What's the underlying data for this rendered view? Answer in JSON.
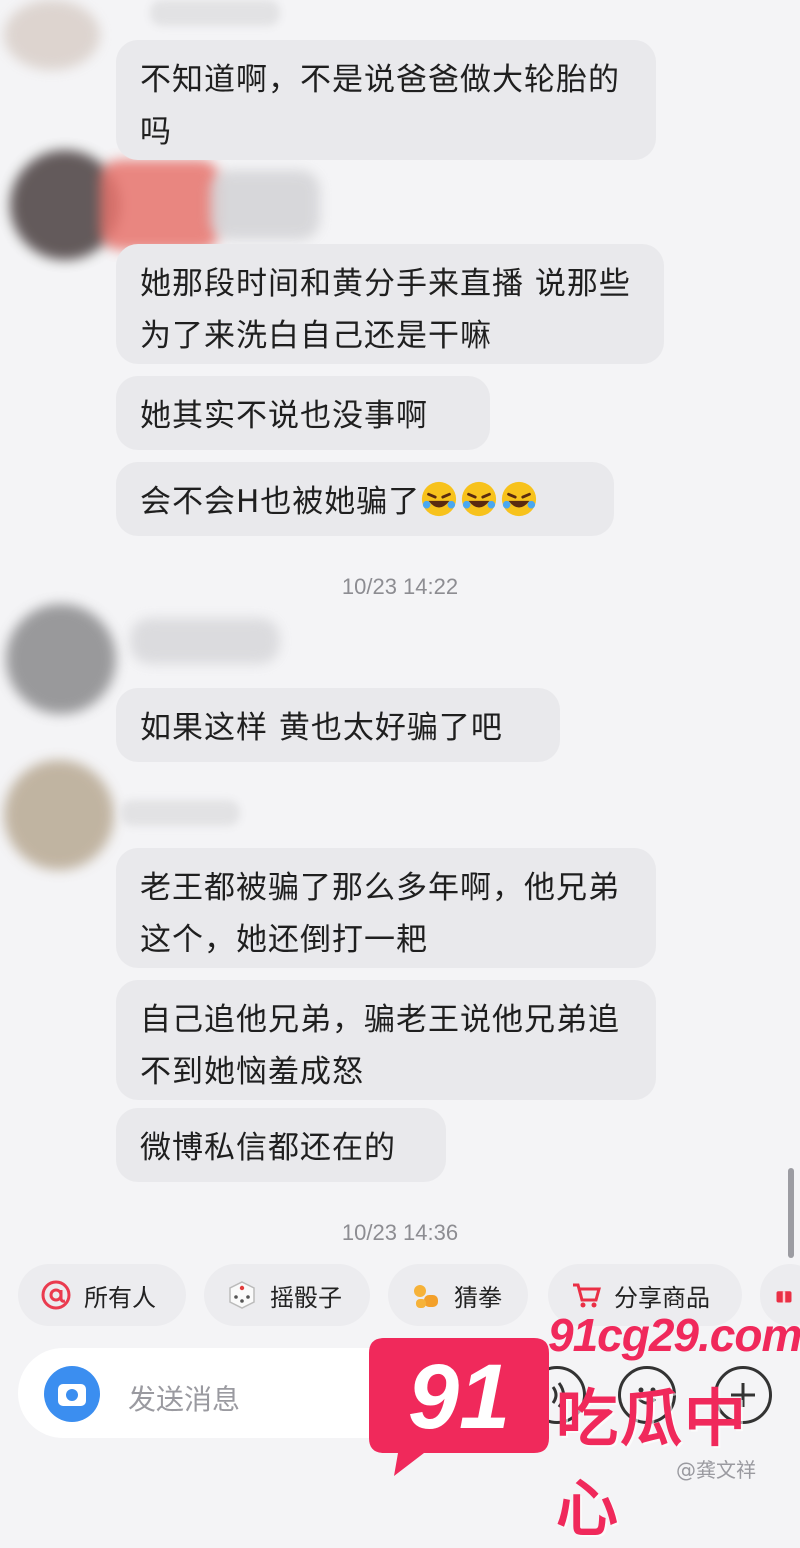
{
  "messages": [
    {
      "text": "不知道啊，不是说爸爸做大轮胎的吗"
    },
    {
      "text": "她那段时间和黄分手来直播 说那些 为了来洗白自己还是干嘛"
    },
    {
      "text": "她其实不说也没事啊"
    },
    {
      "text": "会不会H也被她骗了",
      "emoji": [
        "rofl-emoji",
        "rofl-emoji",
        "rofl-emoji"
      ]
    },
    {
      "text": "如果这样 黄也太好骗了吧"
    },
    {
      "text": "老王都被骗了那么多年啊，他兄弟这个，她还倒打一耙"
    },
    {
      "text": "自己追他兄弟，骗老王说他兄弟追不到她恼羞成怒"
    },
    {
      "text": "微博私信都还在的"
    }
  ],
  "timestamps": [
    "10/23 14:22",
    "10/23 14:36"
  ],
  "quick_actions": [
    {
      "label": "所有人",
      "icon": "at-icon"
    },
    {
      "label": "摇骰子",
      "icon": "dice-icon"
    },
    {
      "label": "猜拳",
      "icon": "fist-icon"
    },
    {
      "label": "分享商品",
      "icon": "cart-icon"
    }
  ],
  "input": {
    "placeholder": "发送消息"
  },
  "watermark": {
    "number": "91",
    "site": "91cg29.com",
    "name": "吃瓜中心",
    "weibo": "@龚文祥"
  },
  "colors": {
    "bubble": "#e9e9ec",
    "brand": "#f0295b",
    "camera": "#3b8ef0"
  }
}
